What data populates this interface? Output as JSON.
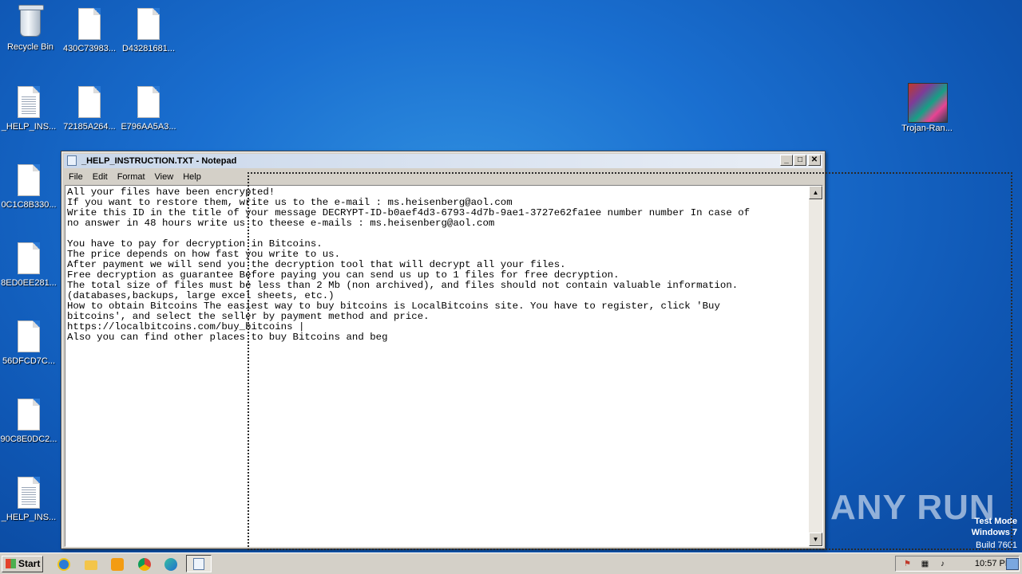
{
  "desktop": {
    "icons": [
      {
        "label": "Recycle Bin",
        "kind": "recycle-bin"
      },
      {
        "label": "430C73983...",
        "kind": "file"
      },
      {
        "label": "D43281681...",
        "kind": "file"
      },
      {
        "label": "_HELP_INS...",
        "kind": "text"
      },
      {
        "label": "72185A264...",
        "kind": "file"
      },
      {
        "label": "E796AA5A3...",
        "kind": "file"
      },
      {
        "label": "0C1C8B330...",
        "kind": "file"
      },
      {
        "label": "8ED0EE281...",
        "kind": "file"
      },
      {
        "label": "56DFCD7C...",
        "kind": "file"
      },
      {
        "label": "90C8E0DC2...",
        "kind": "file"
      },
      {
        "label": "_HELP_INS...",
        "kind": "text"
      },
      {
        "label": "Trojan-Ran...",
        "kind": "image"
      }
    ]
  },
  "notepad": {
    "title": "_HELP_INSTRUCTION.TXT - Notepad",
    "controls": {
      "minimize": "_",
      "maximize": "□",
      "close": "✕"
    },
    "menu": [
      "File",
      "Edit",
      "Format",
      "View",
      "Help"
    ],
    "content": "All your files have been encrypted!\nIf you want to restore them, write us to the e-mail : ms.heisenberg@aol.com\nWrite this ID in the title of your message DECRYPT-ID-b0aef4d3-6793-4d7b-9ae1-3727e62fa1ee number number In case of\nno answer in 48 hours write us to theese e-mails : ms.heisenberg@aol.com\n\nYou have to pay for decryption in Bitcoins.\nThe price depends on how fast you write to us.\nAfter payment we will send you the decryption tool that will decrypt all your files.\nFree decryption as guarantee Before paying you can send us up to 1 files for free decryption.\nThe total size of files must be less than 2 Mb (non archived), and files should not contain valuable information.\n(databases,backups, large excel sheets, etc.)\nHow to obtain Bitcoins The easiest way to buy bitcoins is LocalBitcoins site. You have to register, click 'Buy\nbitcoins', and select the seller by payment method and price.\nhttps://localbitcoins.com/buy_bitcoins |\nAlso you can find other places to buy Bitcoins and beg"
  },
  "watermark": "ANY RUN",
  "os_info": {
    "line1": "Test Mode",
    "line2": "Windows 7",
    "line3": "Build 7601"
  },
  "taskbar": {
    "start_label": "Start",
    "pinned": [
      "internet-explorer",
      "file-explorer",
      "media-player",
      "chrome",
      "edge",
      "notepad"
    ],
    "clock": "10:57 PM"
  },
  "colors": {
    "desktop": "#1a6fd0",
    "titlebar": "#c9d7ea",
    "taskbar": "#d4d0c8"
  }
}
